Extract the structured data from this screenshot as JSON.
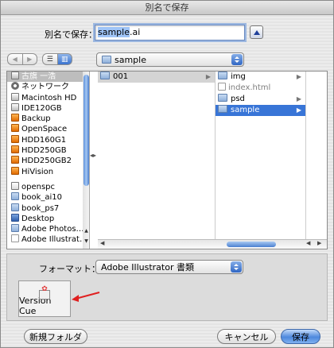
{
  "window": {
    "title": "別名で保存"
  },
  "save_as": {
    "label": "別名で保存：",
    "filename_selected": "sample",
    "filename_ext": ".ai"
  },
  "location": {
    "current": "sample"
  },
  "sidebar": {
    "devices": [
      {
        "label": "古旗 一浩",
        "icon": "disk-icon",
        "selected": true
      },
      {
        "label": "ネットワーク",
        "icon": "network-icon"
      },
      {
        "label": "Macintosh HD",
        "icon": "disk-icon"
      },
      {
        "label": "IDE120GB",
        "icon": "disk-icon"
      },
      {
        "label": "Backup",
        "icon": "external-disk-icon"
      },
      {
        "label": "OpenSpace",
        "icon": "external-disk-icon"
      },
      {
        "label": "HDD160G1",
        "icon": "external-disk-icon"
      },
      {
        "label": "HDD250GB",
        "icon": "external-disk-icon"
      },
      {
        "label": "HDD250GB2",
        "icon": "external-disk-icon"
      },
      {
        "label": "HiVision",
        "icon": "external-disk-icon"
      }
    ],
    "places": [
      {
        "label": "openspc",
        "icon": "home-icon"
      },
      {
        "label": "book_ai10",
        "icon": "folder-icon"
      },
      {
        "label": "book_ps7",
        "icon": "folder-icon"
      },
      {
        "label": "Desktop",
        "icon": "desktop-icon"
      },
      {
        "label": "Adobe Photos…",
        "icon": "folder-icon"
      },
      {
        "label": "Adobe Illustrat…",
        "icon": "document-icon"
      }
    ]
  },
  "columns": {
    "col1": [
      {
        "label": "001",
        "has_children": true
      }
    ],
    "col2": [
      {
        "label": "img",
        "has_children": true
      },
      {
        "label": "index.html",
        "disabled": true
      },
      {
        "label": "psd",
        "has_children": true
      },
      {
        "label": "sample",
        "has_children": true,
        "selected": true
      }
    ]
  },
  "format": {
    "label": "フォーマット：",
    "value": "Adobe Illustrator 書類"
  },
  "version_cue": {
    "label": "Version Cue"
  },
  "buttons": {
    "new_folder": "新規フォルダ",
    "cancel": "キャンセル",
    "save": "保存"
  },
  "colors": {
    "selection": "#3875d7",
    "accent": "#4d88dd",
    "arrow": "#e02020"
  }
}
